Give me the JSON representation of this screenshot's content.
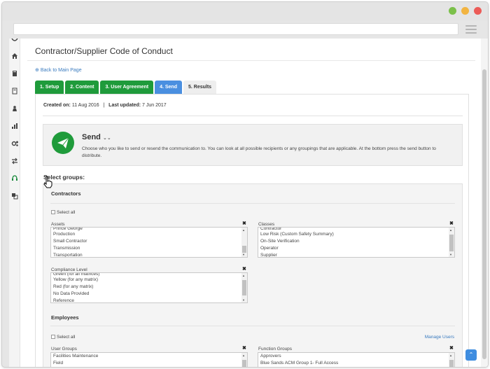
{
  "window": {
    "controls": [
      "minimize-dot",
      "maximize-dot",
      "close-dot"
    ],
    "colors": {
      "green": "#7bc04a",
      "yellow": "#f2b441",
      "red": "#ec5b57"
    }
  },
  "leftnav": {
    "icons": [
      "logo-icon",
      "home-icon",
      "book-icon",
      "document-icon",
      "person-icon",
      "bar-chart-icon",
      "gears-icon",
      "transfer-icon",
      "headset-icon",
      "translate-icon"
    ]
  },
  "page": {
    "title": "Contractor/Supplier Code of Conduct",
    "back_link": "Back to Main Page"
  },
  "tabs": [
    {
      "label": "1. Setup",
      "state": "done"
    },
    {
      "label": "2. Content",
      "state": "done"
    },
    {
      "label": "3. User Agreement",
      "state": "done"
    },
    {
      "label": "4. Send",
      "state": "current"
    },
    {
      "label": "5. Results",
      "state": "next"
    }
  ],
  "meta": {
    "created_label": "Created on:",
    "created_value": "11 Aug 2016",
    "updated_label": "Last updated:",
    "updated_value": "7 Jun 2017"
  },
  "send": {
    "title": "Send",
    "chevron": "⌄⌄",
    "description": "Choose who you like to send or resend the communication to. You can look at all possible recipients or any groupings that are applicable. At the bottom press the send button to distribute."
  },
  "select_groups": {
    "heading": "Select groups:",
    "contractors": {
      "heading": "Contractors",
      "select_all": "Select all",
      "assets": {
        "label": "Assets",
        "options": [
          "Prince George",
          "Production",
          "Small Contractor",
          "Transmission",
          "Transportation"
        ]
      },
      "classes": {
        "label": "Classes",
        "options": [
          "Contractor",
          "Low Risk (Custom Safety Summary)",
          "On-Site Verification",
          "Operator",
          "Supplier"
        ]
      },
      "compliance": {
        "label": "Compliance Level",
        "options": [
          "Green (for all matrices)",
          "Yellow (for any matrix)",
          "Red (for any matrix)",
          "No Data Provided",
          "Reference"
        ]
      }
    },
    "employees": {
      "heading": "Employees",
      "select_all": "Select all",
      "manage_users": "Manage Users",
      "user_groups": {
        "label": "User Groups",
        "options": [
          "Facilities Maintenance",
          "Field"
        ]
      },
      "function_groups": {
        "label": "Function Groups",
        "options": [
          "Approvers",
          "Blue Sands ACM Group 1- Full Access"
        ]
      }
    }
  },
  "colors": {
    "accent_green": "#1f9b3b",
    "accent_blue": "#4a8fe0",
    "link_blue": "#3a7bbf"
  }
}
